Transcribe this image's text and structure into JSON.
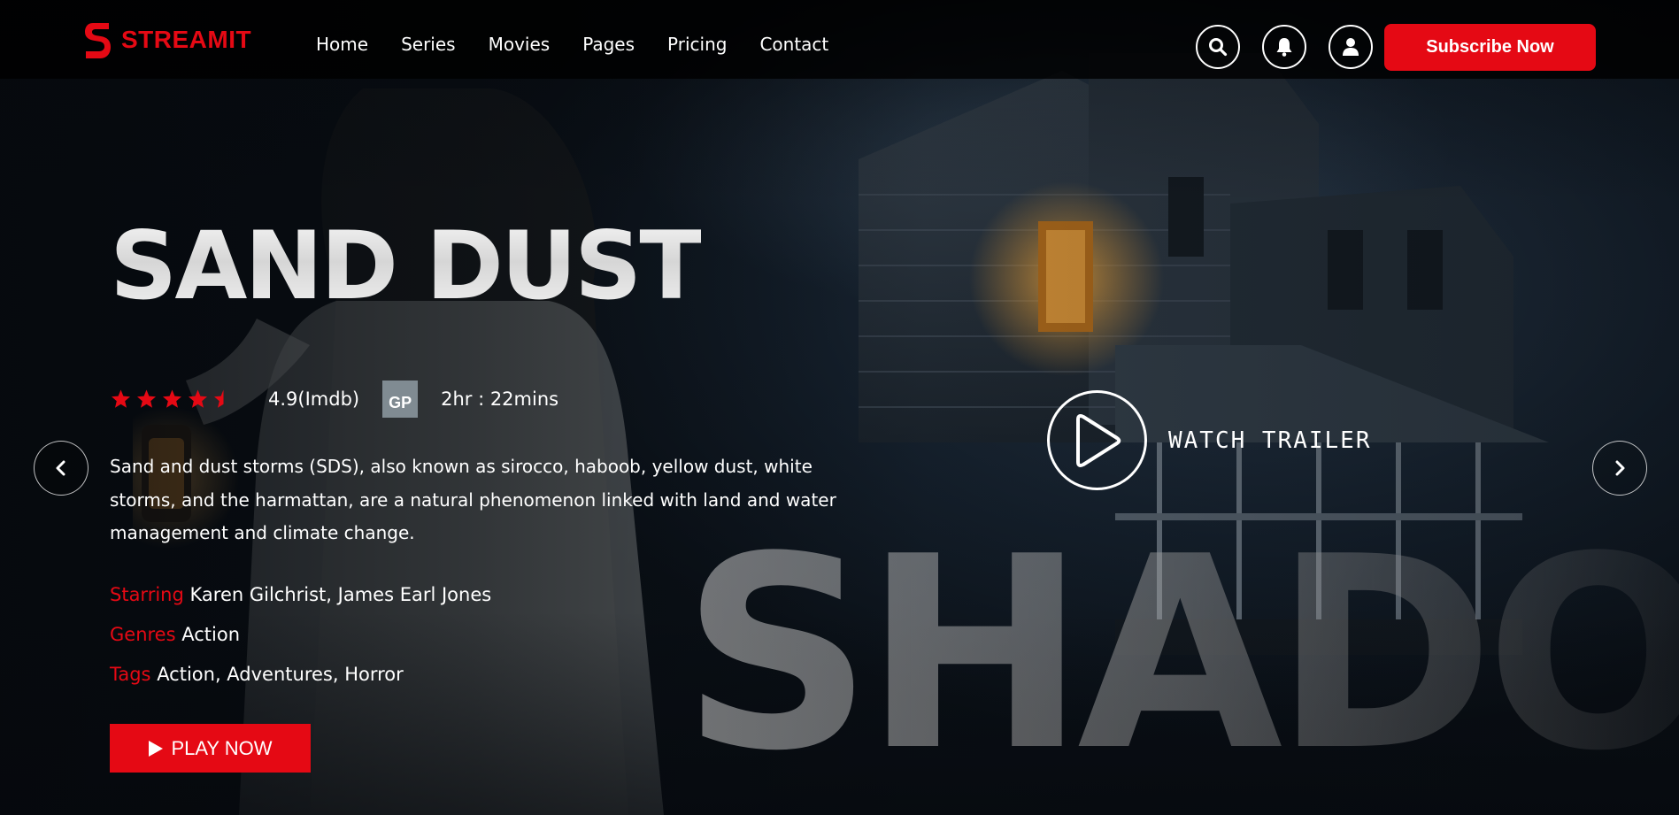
{
  "brand": {
    "name": "STREAMIT",
    "color": "#e50914"
  },
  "nav": {
    "items": [
      {
        "label": "Home"
      },
      {
        "label": "Series"
      },
      {
        "label": "Movies"
      },
      {
        "label": "Pages"
      },
      {
        "label": "Pricing"
      },
      {
        "label": "Contact"
      }
    ]
  },
  "header_actions": {
    "icons": [
      "search-icon",
      "bell-icon",
      "user-icon"
    ],
    "subscribe_label": "Subscribe Now"
  },
  "hero": {
    "title": "SAND DUST",
    "rating_stars": 4.5,
    "rating_text": "4.9(Imdb)",
    "age_badge": "GP",
    "duration": "2hr : 22mins",
    "description": "Sand and dust storms (SDS), also known as sirocco, haboob, yellow dust, white storms, and the harmattan, are a natural phenomenon linked with land and water management and climate change.",
    "starring_label": "Starring",
    "starring_value": "Karen Gilchrist, James Earl Jones",
    "genres_label": "Genres",
    "genres_value": "Action",
    "tags_label": "Tags",
    "tags_value": "Action, Adventures, Horror",
    "play_label": "PLAY NOW",
    "trailer_label": "WATCH TRAILER",
    "background_word": "SHADOW"
  },
  "slider": {
    "prev_icon": "chevron-left-icon",
    "next_icon": "chevron-right-icon"
  }
}
